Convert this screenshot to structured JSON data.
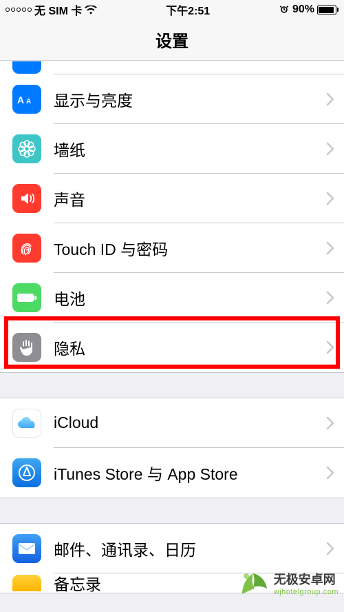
{
  "statusbar": {
    "carrier": "无 SIM 卡",
    "time": "下午2:51",
    "battery_pct": "90%"
  },
  "navbar": {
    "title": "设置"
  },
  "group1": {
    "items": [
      {
        "label": "显示与亮度"
      },
      {
        "label": "墙纸"
      },
      {
        "label": "声音"
      },
      {
        "label": "Touch ID 与密码"
      },
      {
        "label": "电池"
      },
      {
        "label": "隐私"
      }
    ]
  },
  "group2": {
    "items": [
      {
        "label": "iCloud"
      },
      {
        "label": "iTunes Store 与 App Store"
      }
    ]
  },
  "group3": {
    "items": [
      {
        "label": "邮件、通讯录、日历"
      },
      {
        "label": "备忘录"
      }
    ]
  },
  "watermark": {
    "title": "无极安卓网",
    "url": "wjhotelgroup.com"
  }
}
